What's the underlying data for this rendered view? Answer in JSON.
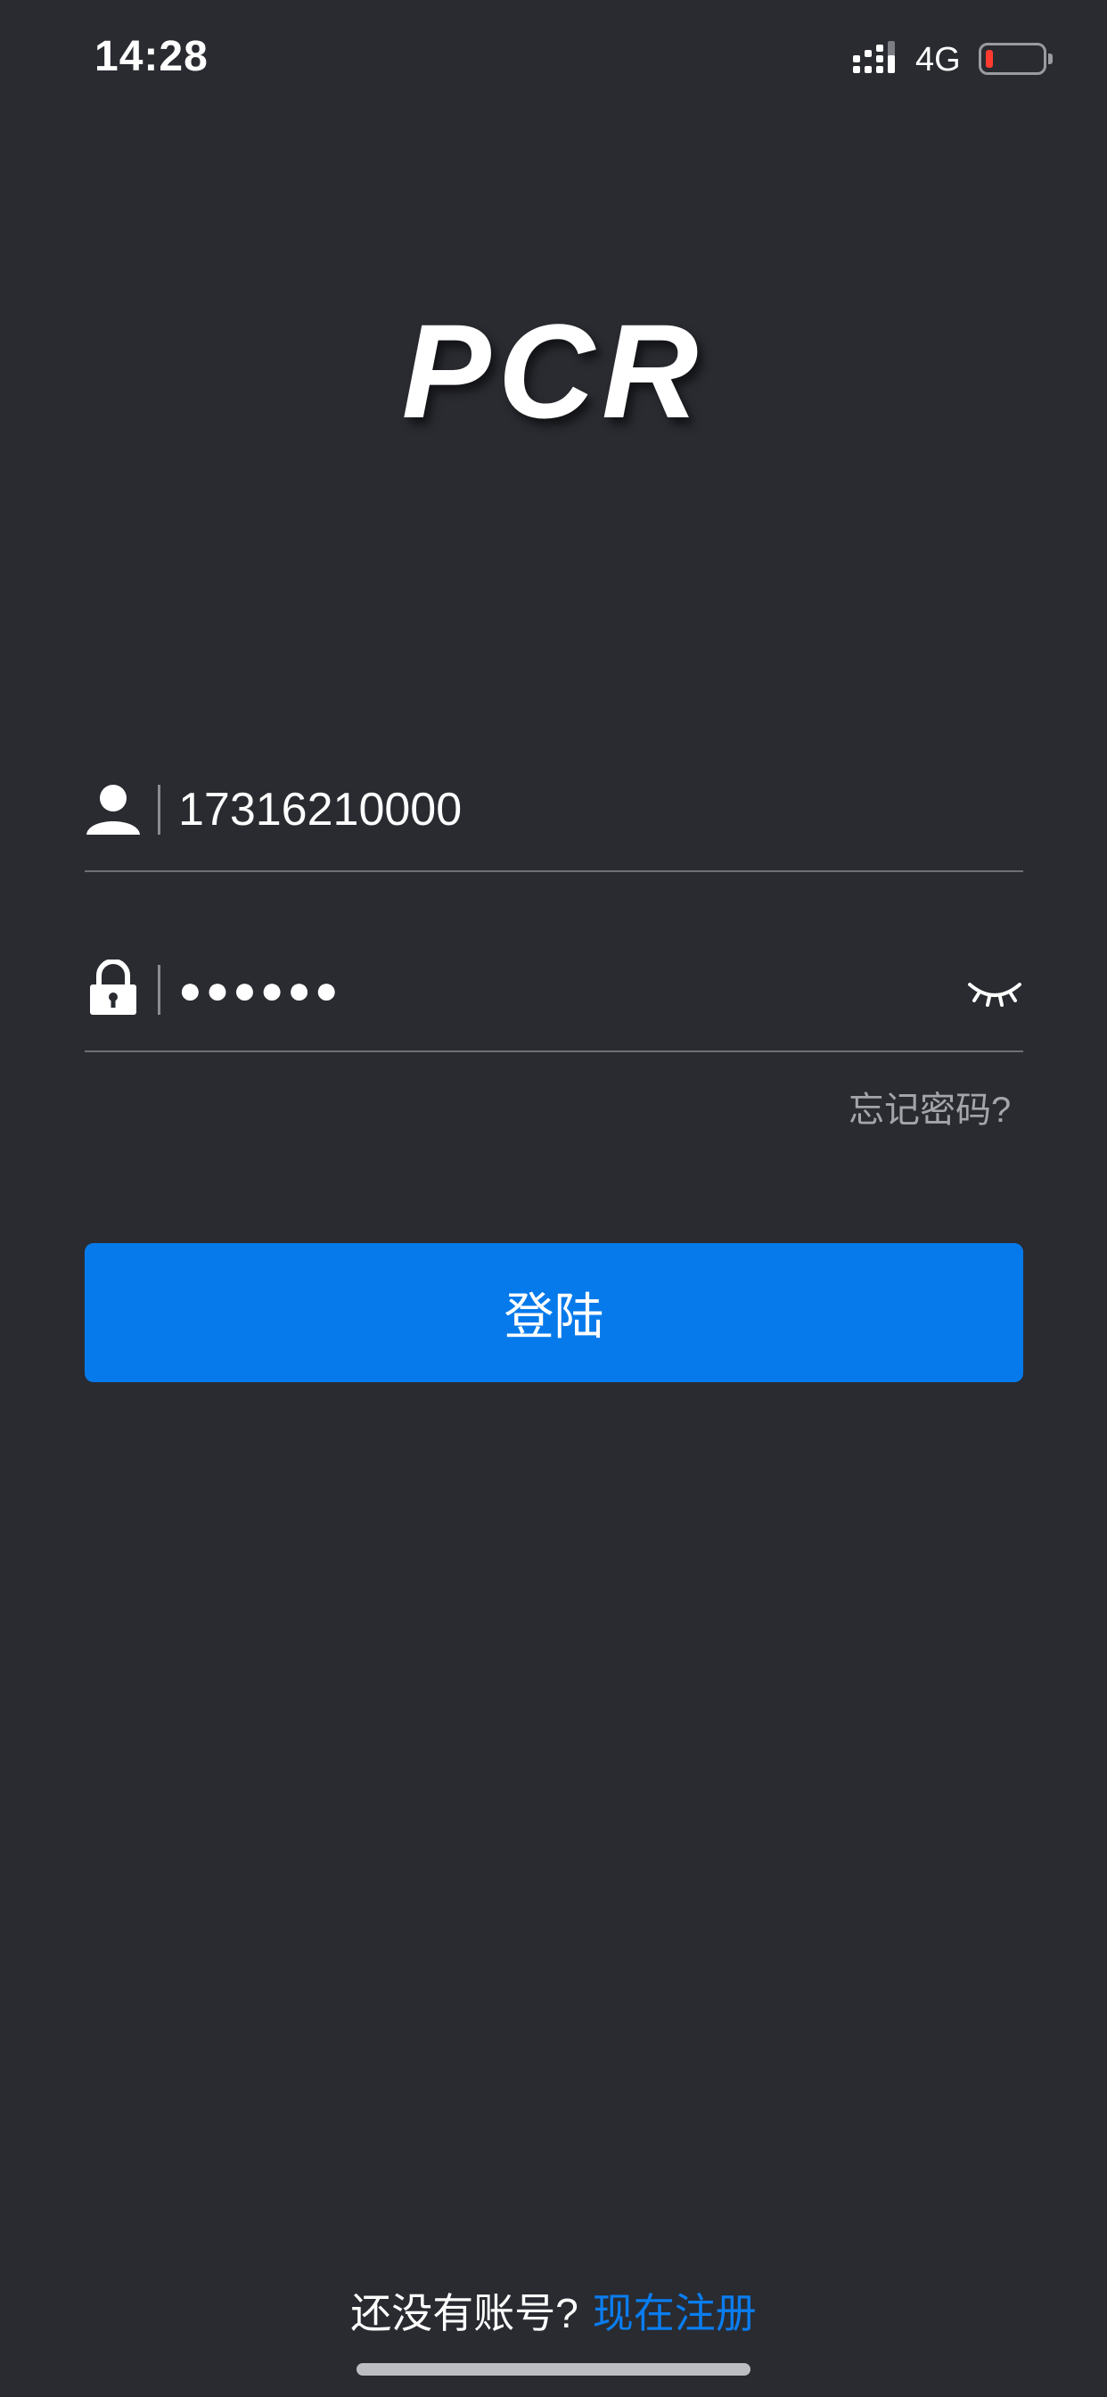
{
  "status_bar": {
    "time": "14:28",
    "network": "4G",
    "icons": [
      "signal-icon",
      "battery-low-icon"
    ],
    "battery_color": "#ff3b30"
  },
  "logo": {
    "text": "PCR"
  },
  "login_form": {
    "username": {
      "icon": "user-icon",
      "value": "17316210000"
    },
    "password": {
      "icon": "lock-icon",
      "masked_value": "●●●●●●",
      "toggle_icon": "eye-closed-icon"
    },
    "forgot_password_label": "忘记密码?",
    "login_button_label": "登陆"
  },
  "footer": {
    "question": "还没有账号?",
    "register_link": "现在注册"
  },
  "colors": {
    "background": "#292b31",
    "primary": "#077aeb",
    "link": "#0a7df0"
  }
}
